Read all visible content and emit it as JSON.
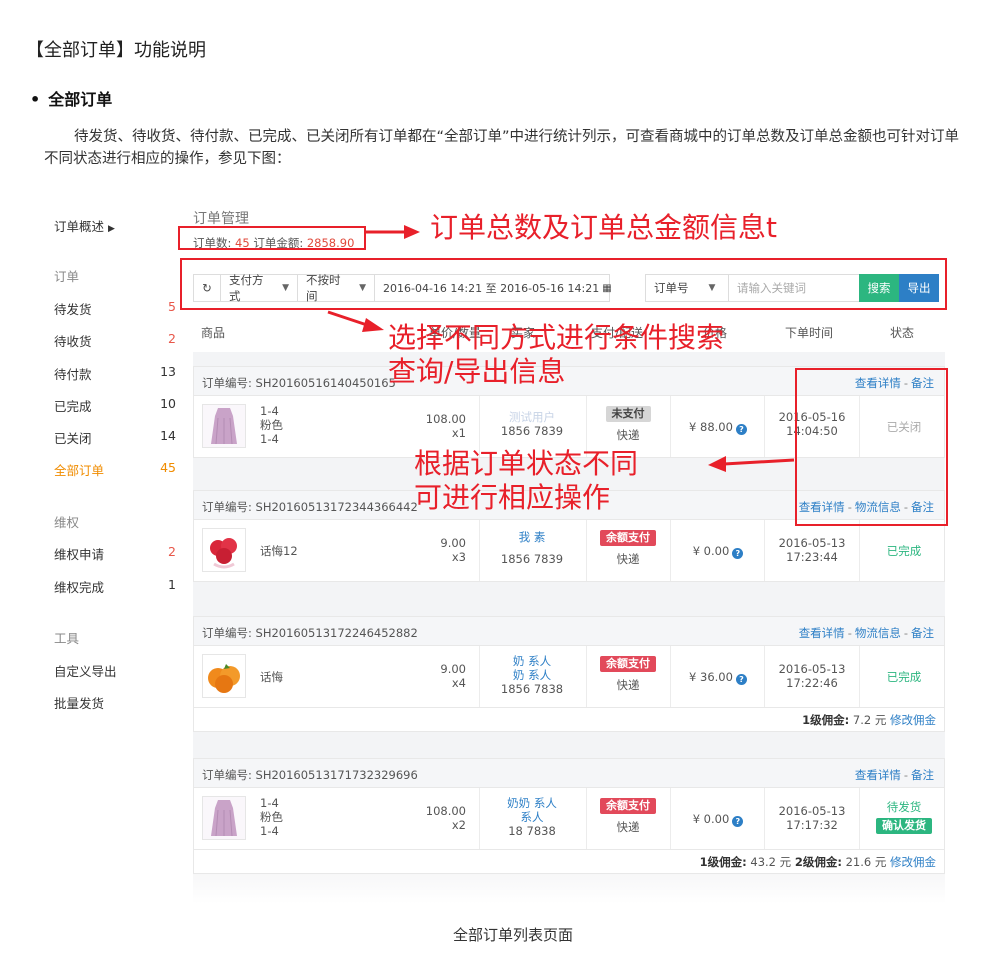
{
  "doc": {
    "title": "【全部订单】功能说明",
    "section_bullet": "•",
    "section_title": "全部订单",
    "paragraph": "待发货、待收货、待付款、已完成、已关闭所有订单都在“全部订单”中进行统计列示，可查看商城中的订单总数及订单总金额也可针对订单不同状态进行相应的操作，参见下图：",
    "caption": "全部订单列表页面"
  },
  "nav": {
    "overview": "订单概述",
    "overview_icon": "triangle-right-icon",
    "group_order": "订单",
    "items": [
      {
        "label": "待发货",
        "count": "5"
      },
      {
        "label": "待收货",
        "count": "2"
      },
      {
        "label": "待付款",
        "count": "13"
      },
      {
        "label": "已完成",
        "count": "10"
      },
      {
        "label": "已关闭",
        "count": "14"
      },
      {
        "label": "全部订单",
        "count": "45"
      }
    ],
    "group_rights": "维权",
    "rights": [
      {
        "label": "维权申请",
        "count": "2"
      },
      {
        "label": "维权完成",
        "count": "1"
      }
    ],
    "group_tools": "工具",
    "tools": [
      {
        "label": "自定义导出"
      },
      {
        "label": "批量发货"
      }
    ]
  },
  "header": {
    "title": "订单管理",
    "count_label": "订单数:",
    "count_value": "45",
    "amount_label": "订单金额:",
    "amount_value": "2858.90"
  },
  "filter": {
    "refresh_icon": "refresh-icon",
    "pay_method": "支付方式",
    "time_mode": "不按时间",
    "date_range": "2016-04-16 14:21 至 2016-05-16 14:21",
    "calendar_icon": "calendar-icon",
    "field": "订单号",
    "keyword_placeholder": "请输入关键词",
    "search": "搜索",
    "export": "导出"
  },
  "columns": [
    "商品",
    "单价/数量",
    "买家",
    "支付/配送",
    "价格",
    "下单时间",
    "状态"
  ],
  "orders": [
    {
      "order_no_label": "订单编号:",
      "order_no": "SH20160516140450165",
      "links": [
        "查看详情",
        "备注"
      ],
      "spec": [
        "1-4",
        "粉色",
        "1-4"
      ],
      "price": "108.00",
      "qty": "x1",
      "buyer": [
        "测试用户",
        "1856    7839"
      ],
      "pay_tag": "未支付",
      "ship": "快递",
      "amount": "¥ 88.00",
      "date": "2016-05-16",
      "time": "14:04:50",
      "status": "已关闭"
    },
    {
      "order_no_label": "订单编号:",
      "order_no": "SH20160513172344366442",
      "links": [
        "查看详情",
        "物流信息",
        "备注"
      ],
      "product_name": "话悔12",
      "price": "9.00",
      "qty": "x3",
      "buyer": [
        "我    素",
        "1856    7839"
      ],
      "pay_tag": "余额支付",
      "ship": "快递",
      "amount": "¥ 0.00",
      "date": "2016-05-13",
      "time": "17:23:44",
      "status": "已完成"
    },
    {
      "order_no_label": "订单编号:",
      "order_no": "SH20160513172246452882",
      "links": [
        "查看详情",
        "物流信息",
        "备注"
      ],
      "product_name": "话悔",
      "price": "9.00",
      "qty": "x4",
      "buyer": [
        "奶    系人",
        "奶    系人",
        "1856    7838"
      ],
      "pay_tag": "余额支付",
      "ship": "快递",
      "amount": "¥ 36.00",
      "date": "2016-05-13",
      "time": "17:22:46",
      "status": "已完成",
      "commission": {
        "l1_label": "1级佣金:",
        "l1": "7.2 元",
        "edit": "修改佣金"
      }
    },
    {
      "order_no_label": "订单编号:",
      "order_no": "SH20160513171732329696",
      "links": [
        "查看详情",
        "备注"
      ],
      "spec": [
        "1-4",
        "粉色",
        "1-4"
      ],
      "price": "108.00",
      "qty": "x2",
      "buyer": [
        "奶奶    系人",
        "    系人",
        "18    7838"
      ],
      "pay_tag": "余额支付",
      "ship": "快递",
      "amount": "¥ 0.00",
      "date": "2016-05-13",
      "time": "17:17:32",
      "status": "待发货",
      "action": "确认发货",
      "commission": {
        "l1_label": "1级佣金:",
        "l1": "43.2 元",
        "l2_label": "2级佣金:",
        "l2": "21.6 元",
        "edit": "修改佣金"
      }
    }
  ],
  "annotations": {
    "a1": "订单总数及订单总金额信息t",
    "a2_line1": "选择不同方式进行条件搜索",
    "a2_line2": "查询/导出信息",
    "a3_line1": "根据订单状态不同",
    "a3_line2": "可进行相应操作"
  },
  "colors": {
    "annotation": "#e8202a",
    "accent_green": "#2cb680",
    "accent_blue": "#2d7fc6",
    "active_orange": "#f08c00"
  }
}
